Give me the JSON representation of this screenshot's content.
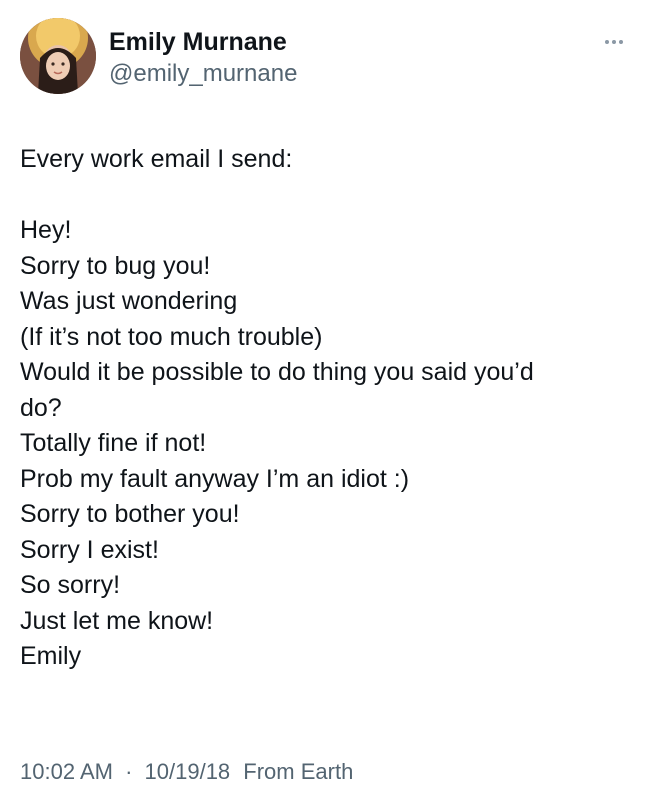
{
  "author": {
    "name": "Emily Murnane",
    "handle": "@emily_murnane",
    "avatar_icon": "user-avatar-photo"
  },
  "menu": {
    "icon": "more-horizontal-icon"
  },
  "tweet": {
    "lines": [
      "Every work email I send:",
      "",
      "Hey!",
      "Sorry to bug you!",
      "Was just wondering",
      "(If it’s not too much trouble)",
      "Would it be possible to do thing you said you’d",
      "do?",
      "Totally fine if not!",
      "Prob my fault anyway I’m an idiot :)",
      "Sorry to bother you!",
      "Sorry I exist!",
      "So sorry!",
      "Just let me know!",
      "Emily"
    ]
  },
  "meta": {
    "time": "10:02 AM",
    "separator": "·",
    "date": "10/19/18",
    "source": "From Earth"
  },
  "colors": {
    "text": "#0f1419",
    "secondary": "#536471",
    "background": "#ffffff"
  }
}
